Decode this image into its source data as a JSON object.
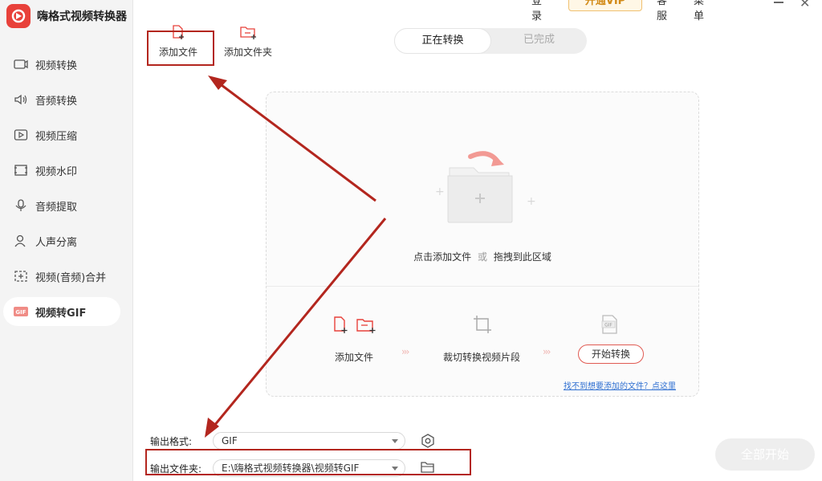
{
  "app": {
    "title": "嗨格式视频转换器"
  },
  "topbar": {
    "login": "登录",
    "vip": "开通VIP",
    "service": "客服",
    "menu": "菜单"
  },
  "sidebar": {
    "items": [
      {
        "label": "视频转换",
        "icon": "video-convert-icon"
      },
      {
        "label": "音频转换",
        "icon": "audio-convert-icon"
      },
      {
        "label": "视频压缩",
        "icon": "video-compress-icon"
      },
      {
        "label": "视频水印",
        "icon": "video-watermark-icon"
      },
      {
        "label": "音频提取",
        "icon": "audio-extract-icon"
      },
      {
        "label": "人声分离",
        "icon": "voice-separate-icon"
      },
      {
        "label": "视频(音频)合并",
        "icon": "merge-icon"
      },
      {
        "label": "视频转GIF",
        "icon": "gif-icon",
        "active": true
      }
    ]
  },
  "toolbar": {
    "add_file": "添加文件",
    "add_folder": "添加文件夹"
  },
  "tabs": {
    "converting": "正在转换",
    "completed": "已完成"
  },
  "dropzone": {
    "hint_click": "点击添加文件",
    "hint_or": "或",
    "hint_drag": "拖拽到此区域",
    "step1": "添加文件",
    "step2": "裁切转换视频片段",
    "step3": "开始转换",
    "find_link": "找不到想要添加的文件？点这里"
  },
  "bottom": {
    "format_label": "输出格式:",
    "format_value": "GIF",
    "folder_label": "输出文件夹:",
    "folder_value": "E:\\嗨格式视频转换器\\视频转GIF",
    "start_all": "全部开始"
  },
  "colors": {
    "accent": "#e8413a",
    "annotation": "#b3261e"
  }
}
